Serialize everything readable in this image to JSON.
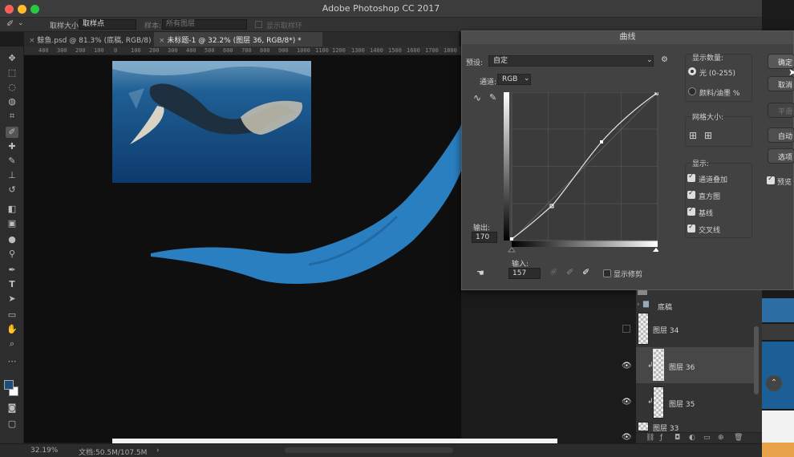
{
  "app": {
    "title": "Adobe Photoshop CC 2017"
  },
  "options_bar": {
    "sample_size_label": "取样大小:",
    "sample_size_value": "取样点",
    "sample_label": "样本:",
    "sample_value": "所有图层",
    "show_ring_label": "显示取样环"
  },
  "tabs": [
    {
      "label": "鲸鱼.psd @ 81.3% (底稿, RGB/8) *"
    },
    {
      "label": "未标题-1 @ 32.2% (图层 36, RGB/8*) *"
    }
  ],
  "ruler": {
    "ticks": [
      "400",
      "300",
      "200",
      "100",
      "0",
      "100",
      "200",
      "300",
      "400",
      "500",
      "600",
      "700",
      "800",
      "900",
      "1000",
      "1100",
      "1200",
      "1300",
      "1400",
      "1500",
      "1600",
      "1700",
      "1800"
    ]
  },
  "status": {
    "zoom": "32.19%",
    "doc": "文档:50.5M/107.5M",
    "arrow": "›"
  },
  "curves": {
    "title": "曲线",
    "preset_label": "预设:",
    "preset_value": "自定",
    "channel_label": "通道:",
    "channel_value": "RGB",
    "output_label": "输出:",
    "output_value": "170",
    "input_label": "输入:",
    "input_value": "157",
    "show_clipping": "显示修剪",
    "display_amount": "显示数量:",
    "light": "光 (0-255)",
    "pigment": "颜料/油墨 %",
    "grid_size": "网格大小:",
    "show": "显示:",
    "channel_overlays": "通道叠加",
    "histogram": "直方图",
    "baseline": "基线",
    "intersection": "交叉线",
    "buttons": {
      "ok": "确定",
      "cancel": "取消",
      "smooth": "平滑",
      "auto": "自动",
      "options": "选项"
    },
    "preview": "预览"
  },
  "layers": {
    "group_name": "底稿",
    "items": [
      {
        "name": "图层 34"
      },
      {
        "name": "图层 36"
      },
      {
        "name": "图层 35"
      },
      {
        "name": "图层 33"
      }
    ]
  },
  "colors": {
    "accent_blue": "#2a7fc0",
    "foreground": "#1c4e78"
  }
}
